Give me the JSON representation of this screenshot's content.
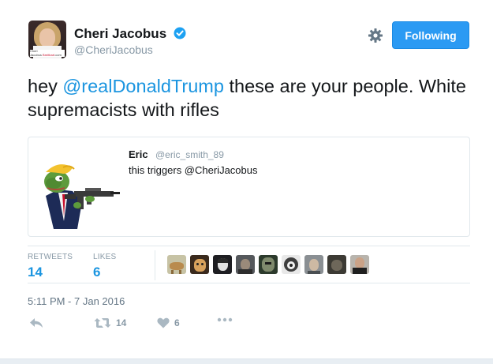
{
  "author": {
    "display_name": "Cheri Jacobus",
    "handle": "@CheriJacobus",
    "verified": true,
    "avatar_caption_line1": "Cheri",
    "avatar_caption_line2": "Jacobus",
    "avatar_caption_red": "Breitbart",
    "avatar_caption_line3": ".com"
  },
  "follow_button": {
    "label": "Following"
  },
  "tweet": {
    "text_prefix": "hey ",
    "mention": "@realDonaldTrump",
    "text_suffix": " these are your people. White supremacists with rifles"
  },
  "quoted_tweet": {
    "name": "Eric",
    "handle": "@eric_smith_89",
    "text": "this triggers @CheriJacobus"
  },
  "stats": {
    "retweets_label": "RETWEETS",
    "retweets_value": "14",
    "likes_label": "LIKES",
    "likes_value": "6",
    "likers_count": 9
  },
  "timestamp": "5:11 PM - 7 Jan 2016",
  "actions": {
    "reply_icon": "reply-icon",
    "retweet_icon": "retweet-icon",
    "retweet_count": "14",
    "like_icon": "heart-icon",
    "like_count": "6",
    "more_icon": "more-icon"
  },
  "colors": {
    "accent": "#1b95e0",
    "follow_button_bg": "#2b9af3",
    "muted": "#8899a6"
  }
}
